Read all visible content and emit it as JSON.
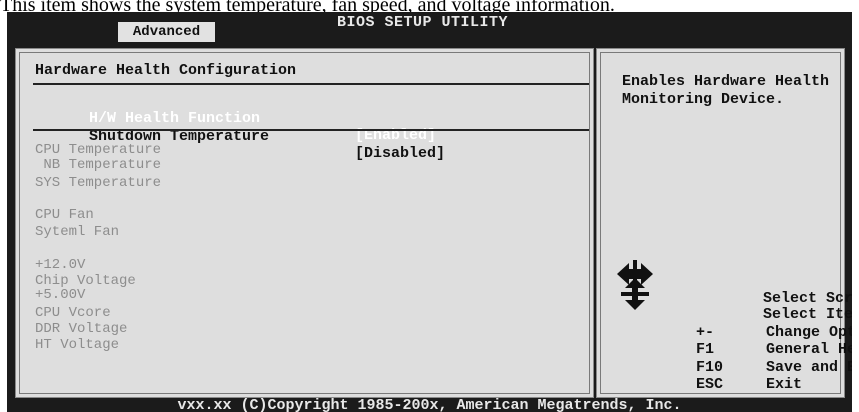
{
  "caption": "This item shows the system temperature, fan speed, and voltage information.",
  "window": {
    "title": "BIOS SETUP UTILITY",
    "active_tab": "Advanced"
  },
  "panel": {
    "section_title": "Hardware Health Configuration",
    "options": [
      {
        "label": "H/W Health Function",
        "value": "[Enabled]",
        "highlighted": true
      },
      {
        "label": "Shutdown Temperature",
        "value": "[Disabled]",
        "highlighted": false
      }
    ],
    "sensors": {
      "cpu_temp": "CPU Temperature",
      "nb_temp": " NB Temperature",
      "sys_temp": "SYS Temperature",
      "cpu_fan": "CPU Fan",
      "system_fan": "Syteml Fan",
      "v12": "+12.0V",
      "chip_voltage": "Chip Voltage",
      "v5": "+5.00V",
      "cpu_vcore": "CPU Vcore",
      "ddr_voltage": "DDR Voltage",
      "ht_voltage": "HT Voltage"
    }
  },
  "help": {
    "text": "Enables Hardware Health Monitoring Device.",
    "keys": [
      {
        "key": "",
        "icon": "arrows-left-right-icon",
        "desc": "Select Screen"
      },
      {
        "key": "",
        "icon": "arrows-up-down-icon",
        "desc": "Select Item"
      },
      {
        "key": "+-",
        "desc": "Change Option"
      },
      {
        "key": "F1",
        "desc": "General Help"
      },
      {
        "key": "F10",
        "desc": "Save and Exit"
      },
      {
        "key": "ESC",
        "desc": "Exit"
      }
    ]
  },
  "footer": "vxx.xx (C)Copyright 1985-200x, American Megatrends, Inc.",
  "colors": {
    "background": "#1b1b1b",
    "panel": "#dedede",
    "highlight_text": "#ffffff",
    "dim_text": "#8d8d8d"
  }
}
